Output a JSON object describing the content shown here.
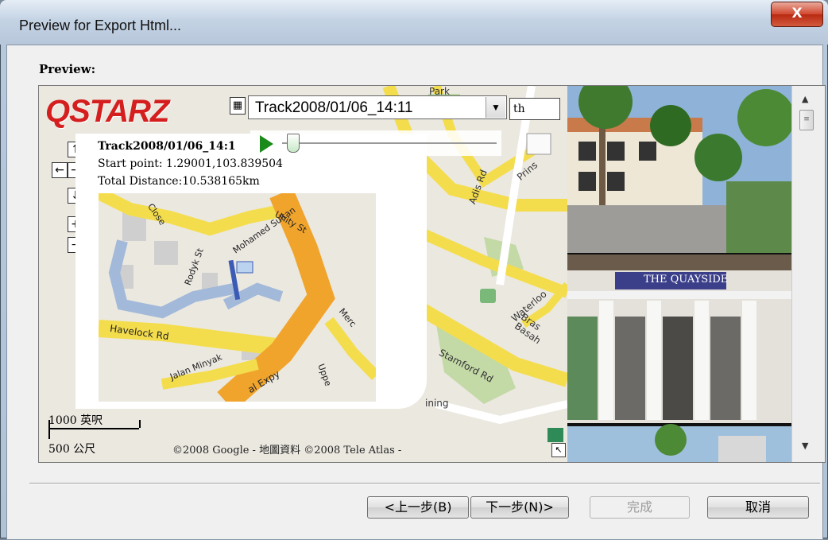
{
  "window": {
    "title": "Preview for Export Html...",
    "close_label": "X"
  },
  "preview": {
    "label": "Preview:"
  },
  "map": {
    "logo_text": "QSTARZ",
    "track_select_value": "Track2008/01/06_14:11",
    "search_value": "th",
    "info": {
      "title": "Track2008/01/06_14:1",
      "start_point": "Start point: 1.29001,103.839504",
      "total_distance": "Total Distance:10.538165km"
    },
    "scale_top": "1000 英呎",
    "scale_bottom": "500 公尺",
    "copyright": "©2008 Google - 地圖資料 ©2008 Tele Atlas -",
    "street_labels": {
      "havelock": "Havelock Rd",
      "jalan_minyak": "Jalan Minyak",
      "mohamed_sultan": "Mohamed Sultan",
      "unity": "Unity St",
      "rodyk": "Rodyk St",
      "close": "Close",
      "stamford": "Stamford Rd",
      "bras_basah": "Bras Basah",
      "waterloo": "Waterloo",
      "park": "Park",
      "merc": "Merc",
      "cal_expy": "al Expy",
      "upper": "Uppe",
      "adis": "Adis Rd",
      "prince": "Prins",
      "ining": "ining"
    }
  },
  "photos": {
    "sign_text": "THE QUAYSIDE"
  },
  "buttons": {
    "back": "<上一步(B)",
    "next": "下一步(N)>",
    "finish": "完成",
    "cancel": "取消"
  },
  "colors": {
    "road_yellow": "#f4dd4d",
    "road_orange": "#f0a42c",
    "river_blue": "#a2b9d9",
    "park_green": "#b9d7a0",
    "close_red": "#c8391d"
  }
}
